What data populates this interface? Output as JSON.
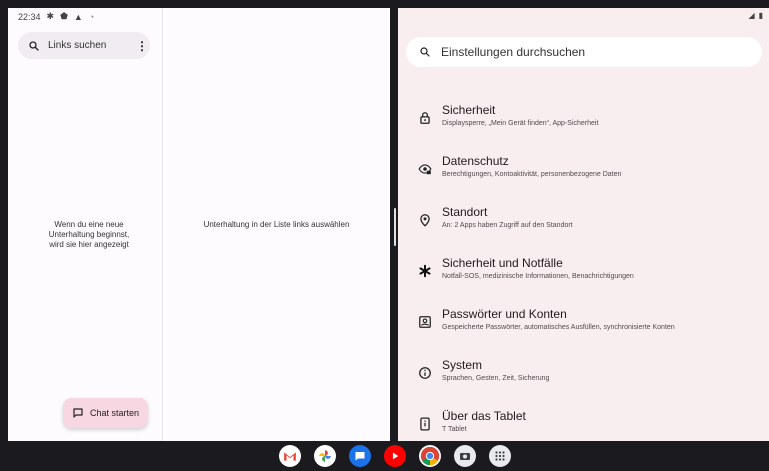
{
  "status_bar": {
    "time": "22:34"
  },
  "messages": {
    "search_label": "Links suchen",
    "empty_state": "Wenn du eine neue Unterhaltung beginnst, wird sie hier angezeigt",
    "detail_hint": "Unterhaltung in der Liste links auswählen",
    "fab_label": "Chat starten"
  },
  "settings": {
    "search_placeholder": "Einstellungen durchsuchen",
    "items": [
      {
        "icon": "lock-icon",
        "title": "Sicherheit",
        "subtitle": "Displaysperre, „Mein Gerät finden“, App-Sicherheit"
      },
      {
        "icon": "privacy-eye-icon",
        "title": "Datenschutz",
        "subtitle": "Berechtigungen, Kontoaktivität, personenbezogene Daten"
      },
      {
        "icon": "location-pin-icon",
        "title": "Standort",
        "subtitle": "An: 2 Apps haben Zugriff auf den Standort"
      },
      {
        "icon": "emergency-asterisk-icon",
        "title": "Sicherheit und Notfälle",
        "subtitle": "Notfall-SOS, medizinische Informationen, Benachrichtigungen"
      },
      {
        "icon": "password-account-icon",
        "title": "Passwörter und Konten",
        "subtitle": "Gespeicherte Passwörter, automatisches Ausfüllen, synchronisierte Konten"
      },
      {
        "icon": "info-icon",
        "title": "System",
        "subtitle": "Sprachen, Gesten, Zeit, Sicherung"
      },
      {
        "icon": "tablet-info-icon",
        "title": "Über das Tablet",
        "subtitle": "T Tablet"
      }
    ]
  },
  "dock": [
    {
      "name": "gmail-icon",
      "color": "#ffffff"
    },
    {
      "name": "photos-icon",
      "color": "#ffffff"
    },
    {
      "name": "messages-icon",
      "color": "#1a73e8"
    },
    {
      "name": "youtube-icon",
      "color": "#ff0000"
    },
    {
      "name": "chrome-icon",
      "color": "#ffffff"
    },
    {
      "name": "camera-icon",
      "color": "#e8eaed"
    },
    {
      "name": "app-drawer-icon",
      "color": "#e8eaed"
    }
  ]
}
